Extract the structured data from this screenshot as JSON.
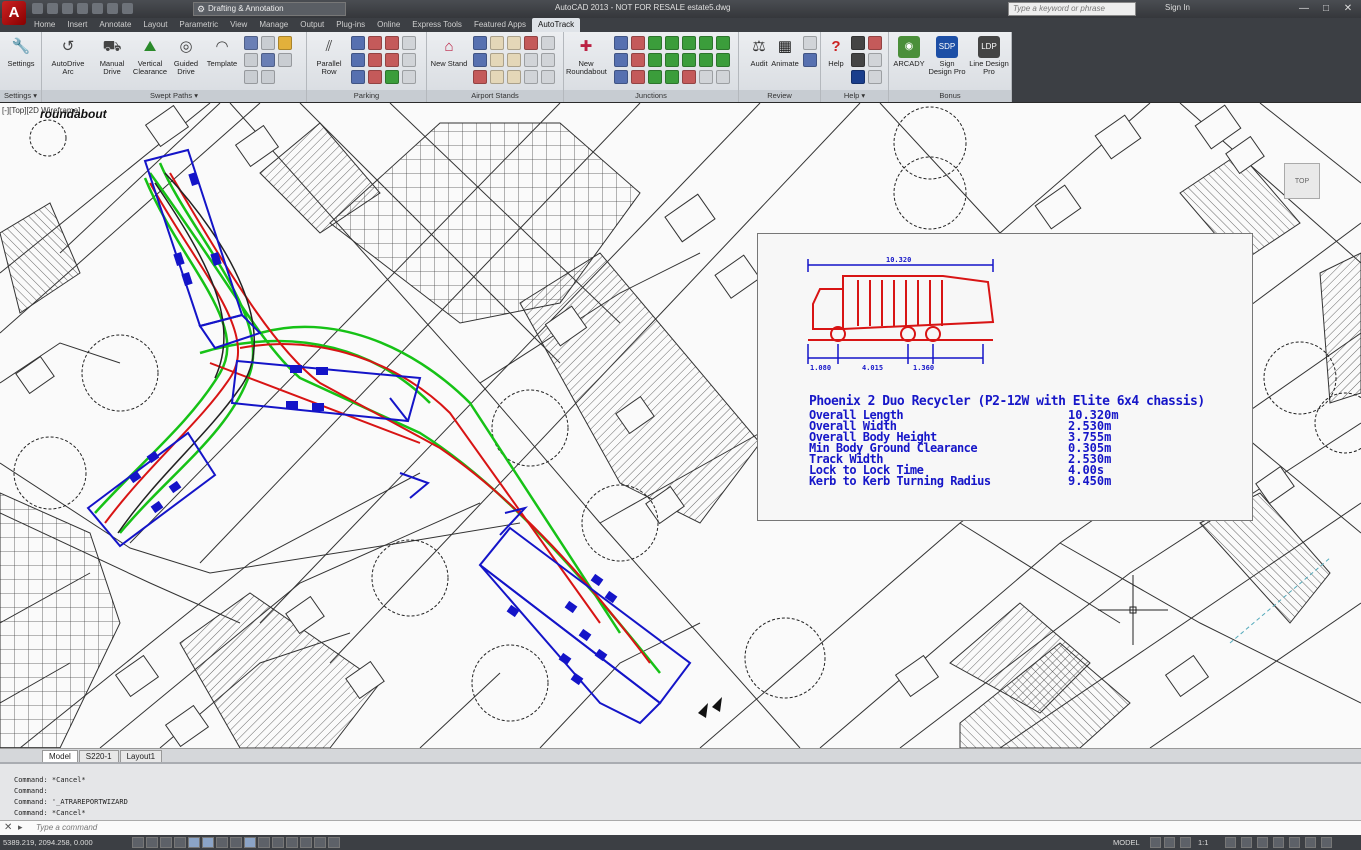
{
  "app": {
    "logo_letter": "A",
    "window_title": "AutoCAD 2013 - NOT FOR RESALE    estate5.dwg",
    "workspace": "Drafting & Annotation",
    "search_placeholder": "Type a keyword or phrase",
    "sign_in": "Sign In",
    "window_buttons": [
      "—",
      "□",
      "✕"
    ]
  },
  "ribbon_tabs": [
    "Home",
    "Insert",
    "Annotate",
    "Layout",
    "Parametric",
    "View",
    "Manage",
    "Output",
    "Plug-ins",
    "Online",
    "Express Tools",
    "Featured Apps",
    "AutoTrack"
  ],
  "active_tab": "AutoTrack",
  "ribbon": {
    "panels": {
      "settings": "Settings ▾",
      "swept_paths": "Swept Paths ▾",
      "parking": "Parking",
      "airport_stands": "Airport Stands",
      "junctions": "Junctions",
      "review": "Review",
      "help": "Help ▾",
      "bonus": "Bonus"
    },
    "buttons": {
      "settings": "Settings",
      "autodrive_arc": "AutoDrive Arc",
      "manual_drive": "Manual Drive",
      "vertical_clearance": "Vertical Clearance",
      "guided_drive": "Guided Drive",
      "template": "Template",
      "parallel_row": "Parallel Row",
      "new_stand": "New Stand",
      "new_roundabout": "New Roundabout",
      "audit": "Audit",
      "animate": "Animate",
      "help": "Help",
      "arcady": "ARCADY",
      "sign_design_pro": "Sign Design Pro",
      "line_design_pro": "Line Design Pro"
    }
  },
  "drawing": {
    "viewport_label": "[-][Top][2D Wireframe]",
    "name": "roundabout",
    "viewcube_label": "TOP"
  },
  "vehicle": {
    "name": "Phoenix 2 Duo Recycler (P2-12W with Elite 6x4 chassis)",
    "overall_dimension": "10.320",
    "front_overhang": "1.080",
    "wheelbase": "4.015",
    "rear_axle_spacing": "1.360",
    "specs": [
      {
        "label": "Overall Length",
        "value": "10.320m"
      },
      {
        "label": "Overall Width",
        "value": "2.530m"
      },
      {
        "label": "Overall Body Height",
        "value": "3.755m"
      },
      {
        "label": "Min Body Ground Clearance",
        "value": "0.305m"
      },
      {
        "label": "Track Width",
        "value": "2.530m"
      },
      {
        "label": "Lock to Lock Time",
        "value": "4.00s"
      },
      {
        "label": "Kerb to Kerb Turning Radius",
        "value": "9.450m"
      }
    ]
  },
  "layout_tabs": [
    "Model",
    "S220-1",
    "Layout1"
  ],
  "active_layout": "Model",
  "command": {
    "history": [
      "Command: *Cancel*",
      "Command:",
      "Command: '_ATRAREPORTWIZARD",
      "Command: *Cancel*"
    ],
    "placeholder": "Type a command"
  },
  "status": {
    "coordinates": "5389.219, 2094.258, 0.000",
    "model": "MODEL",
    "scale": "1:1"
  },
  "colors": {
    "path_green": "#16c216",
    "path_red": "#d81414",
    "vehicle_blue": "#1414c8",
    "linework": "#333333"
  }
}
